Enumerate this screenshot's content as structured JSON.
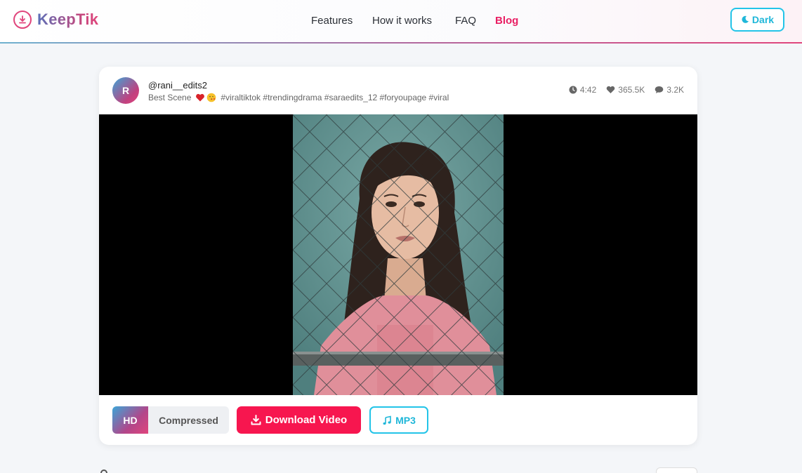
{
  "header": {
    "logo_text": "KeepTik",
    "nav": [
      "Features",
      "How it works",
      "FAQ",
      "Blog"
    ],
    "active_nav": "Blog",
    "theme_toggle_label": "Dark"
  },
  "video_card": {
    "avatar_letter": "R",
    "username": "@rani__edits2",
    "caption_prefix": "Best Scene",
    "caption_hashtags": "#viraltiktok #trendingdrama #saraedits_12 #foryoupage #viral",
    "stats": {
      "duration": "4:42",
      "likes": "365.5K",
      "comments": "3.2K"
    },
    "quality_options": [
      "HD",
      "Compressed"
    ],
    "selected_quality": "HD",
    "download_label": "Download Video",
    "mp3_label": "MP3"
  },
  "icons": {
    "logo": "download-circle-icon",
    "theme": "moon-icon",
    "duration": "clock-icon",
    "likes": "heart-icon",
    "comments": "comment-icon",
    "download": "download-icon",
    "mp3": "music-note-icon"
  },
  "colors": {
    "accent_pink": "#f7164f",
    "accent_cyan": "#23c4e8",
    "active_nav": "#e91e63",
    "background": "#f4f6f9"
  }
}
